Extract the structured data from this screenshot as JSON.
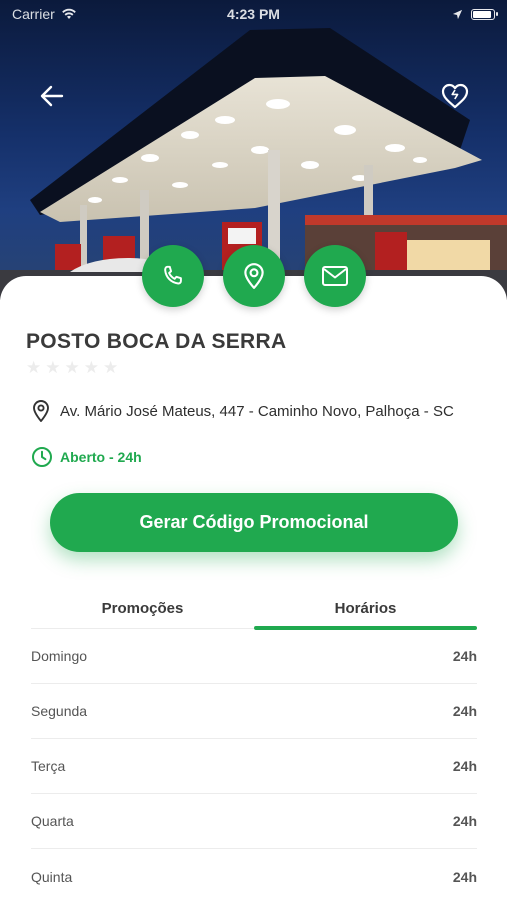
{
  "status_bar": {
    "carrier": "Carrier",
    "time": "4:23 PM"
  },
  "header": {
    "back_icon": "arrow-left-icon",
    "favorite_icon": "heart-icon"
  },
  "contact_actions": [
    {
      "icon": "phone-icon"
    },
    {
      "icon": "map-pin-icon"
    },
    {
      "icon": "mail-icon"
    }
  ],
  "station": {
    "name": "POSTO BOCA DA SERRA",
    "rating_stars": 0,
    "rating_max": 5,
    "address": "Av. Mário José Mateus, 447 - Caminho Novo, Palhoça - SC",
    "hours_status": "Aberto - 24h"
  },
  "promo_button": {
    "label": "Gerar Código Promocional"
  },
  "tabs": [
    {
      "label": "Promoções",
      "active": false
    },
    {
      "label": "Horários",
      "active": true
    }
  ],
  "schedule": [
    {
      "day": "Domingo",
      "hours": "24h"
    },
    {
      "day": "Segunda",
      "hours": "24h"
    },
    {
      "day": "Terça",
      "hours": "24h"
    },
    {
      "day": "Quarta",
      "hours": "24h"
    },
    {
      "day": "Quinta",
      "hours": "24h"
    }
  ],
  "colors": {
    "accent": "#20a94f",
    "text_dark": "#3a3a3a",
    "divider": "#ececec"
  }
}
